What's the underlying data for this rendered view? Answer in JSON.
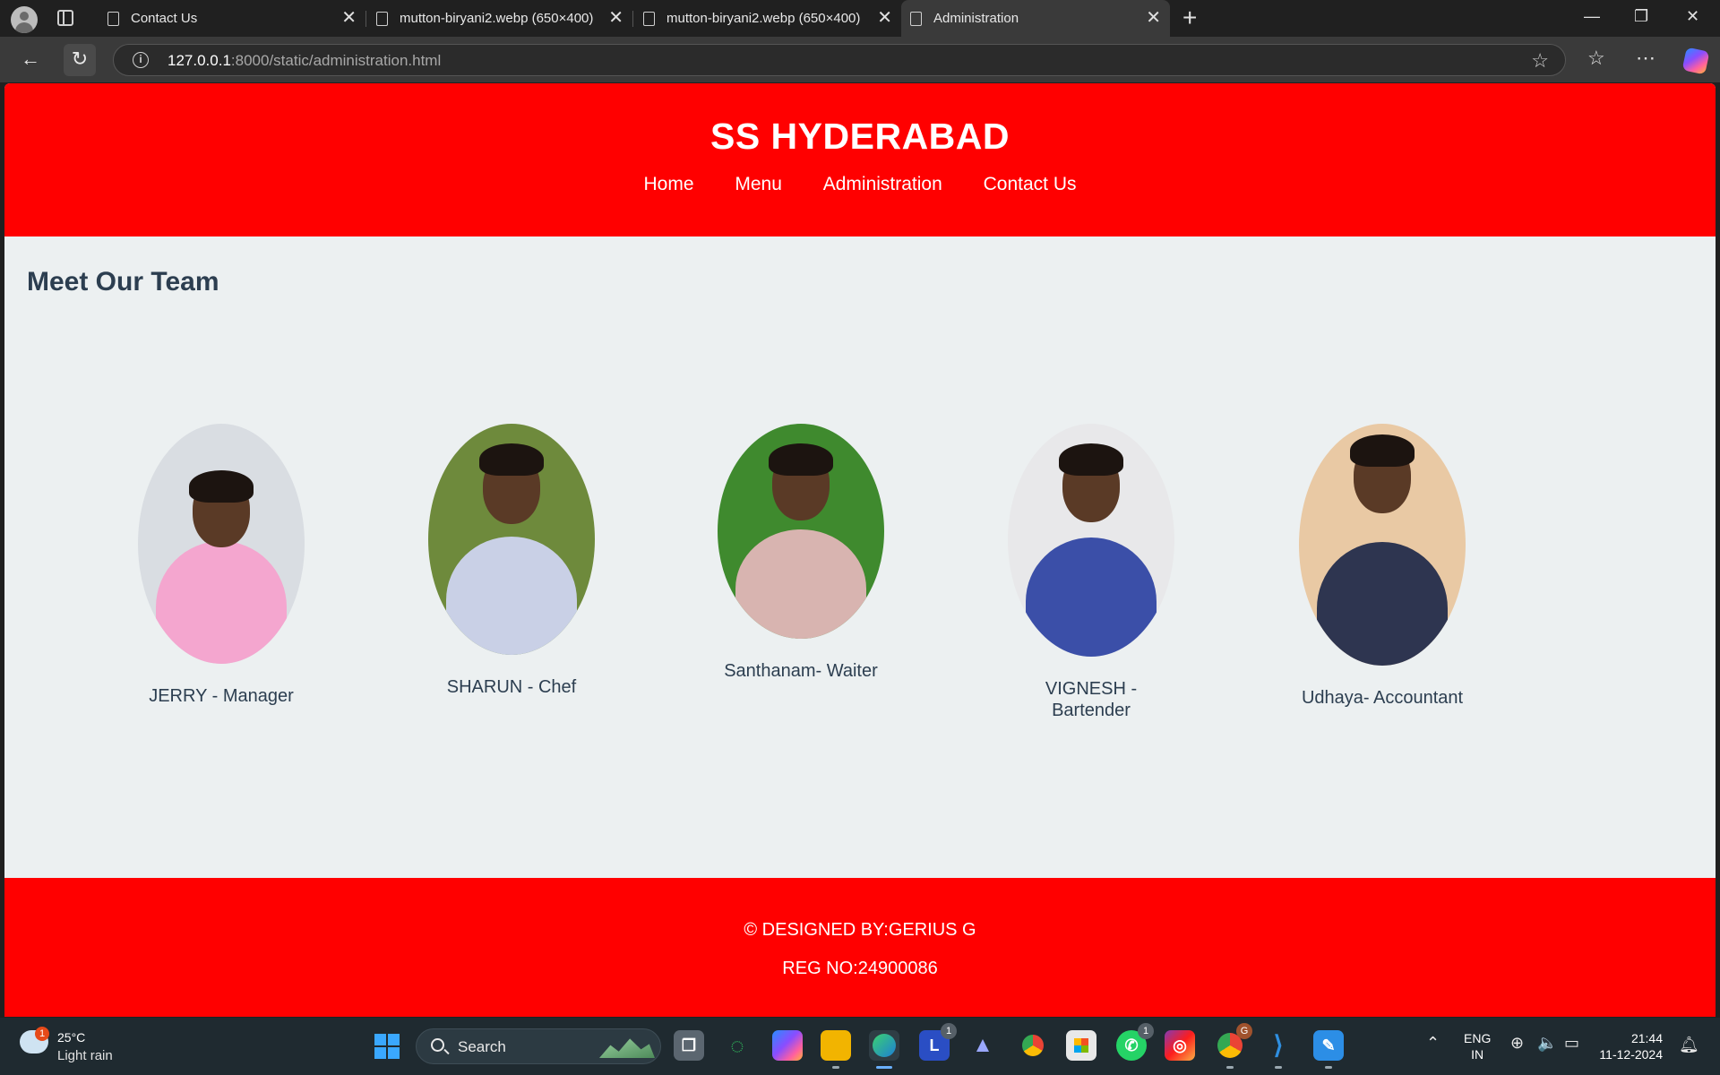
{
  "browser": {
    "tabs": [
      {
        "title": "Contact Us"
      },
      {
        "title": "mutton-biryani2.webp (650×400)"
      },
      {
        "title": "mutton-biryani2.webp (650×400)"
      },
      {
        "title": "Administration"
      }
    ],
    "url_host": "127.0.0.1",
    "url_rest": ":8000/static/administration.html"
  },
  "site": {
    "title": "SS HYDERABAD",
    "nav": [
      "Home",
      "Menu",
      "Administration",
      "Contact Us"
    ],
    "heading": "Meet Our Team",
    "team": [
      {
        "name": "JERRY - Manager",
        "shirt": "#f4a6cf",
        "bg": "#d9dde2"
      },
      {
        "name": "SHARUN - Chef",
        "shirt": "#c9d0e6",
        "bg": "#6e8a3c"
      },
      {
        "name": "Santhanam- Waiter",
        "shirt": "#d8b4b0",
        "bg": "#3f8a2e"
      },
      {
        "name": "VIGNESH - Bartender",
        "shirt": "#3b4fa8",
        "bg": "#e8e8ea"
      },
      {
        "name": "Udhaya- Accountant",
        "shirt": "#2e3550",
        "bg": "#e9c9a4"
      }
    ],
    "footer_line1": "© DESIGNED BY:GERIUS G",
    "footer_line2": "REG NO:24900086"
  },
  "colors": {
    "brand_red": "#ff0000",
    "page_bg": "#ecf0f1",
    "heading_text": "#2c3e50"
  },
  "taskbar": {
    "weather_badge": "1",
    "temperature": "25°C",
    "condition": "Light rain",
    "search_placeholder": "Search",
    "apps": [
      {
        "icon": "task-view-icon"
      },
      {
        "icon": "xbox-icon"
      },
      {
        "icon": "copilot-icon"
      },
      {
        "icon": "file-explorer-icon"
      },
      {
        "icon": "edge-icon"
      },
      {
        "icon": "l-app-icon",
        "badge": "1"
      },
      {
        "icon": "arc-icon"
      },
      {
        "icon": "chrome-icon"
      },
      {
        "icon": "microsoft-store-icon"
      },
      {
        "icon": "whatsapp-icon",
        "badge": "1"
      },
      {
        "icon": "instagram-icon"
      },
      {
        "icon": "chrome-profile-icon",
        "badge": "G"
      },
      {
        "icon": "vscode-icon"
      },
      {
        "icon": "paint-icon"
      }
    ],
    "lang_line1": "ENG",
    "lang_line2": "IN",
    "time": "21:44",
    "date": "11-12-2024"
  }
}
